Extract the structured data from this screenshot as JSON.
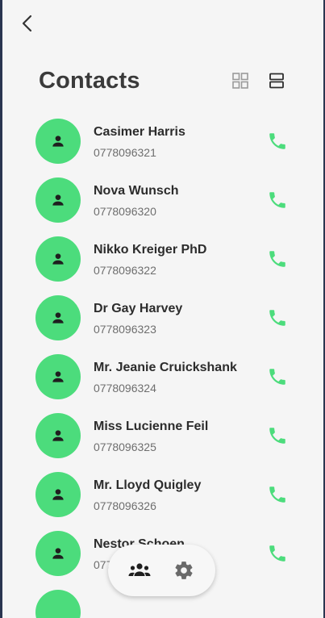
{
  "header": {
    "back_icon": "chevron-left-icon",
    "title": "Contacts",
    "grid_view_icon": "grid-view-icon",
    "list_view_icon": "list-view-icon"
  },
  "colors": {
    "accent": "#4cdc7c",
    "background": "#f5f5f5",
    "title": "#3a3a3a",
    "subtitle": "#6e6e6e"
  },
  "contacts": [
    {
      "name": "Casimer Harris",
      "phone": "0778096321"
    },
    {
      "name": "Nova Wunsch",
      "phone": "0778096320"
    },
    {
      "name": "Nikko Kreiger PhD",
      "phone": "0778096322"
    },
    {
      "name": "Dr Gay Harvey",
      "phone": "0778096323"
    },
    {
      "name": "Mr. Jeanie Cruickshank",
      "phone": "0778096324"
    },
    {
      "name": "Miss Lucienne Feil",
      "phone": "0778096325"
    },
    {
      "name": "Mr. Lloyd Quigley",
      "phone": "0778096326"
    },
    {
      "name": "Nestor Schoen",
      "phone": "0778096327"
    }
  ],
  "bottom_nav": {
    "items": [
      {
        "icon": "groups-icon"
      },
      {
        "icon": "settings-gear-icon"
      }
    ]
  }
}
